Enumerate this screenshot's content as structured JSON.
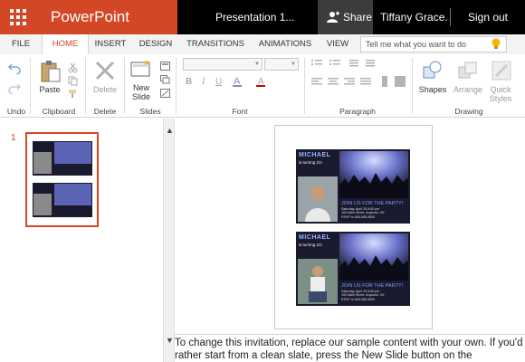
{
  "titlebar": {
    "app_name": "PowerPoint Online",
    "doc_title": "Presentation 1...",
    "share_label": "Share",
    "user": "Tiffany Grace...",
    "signout": "Sign out"
  },
  "tabs": [
    "FILE",
    "HOME",
    "INSERT",
    "DESIGN",
    "TRANSITIONS",
    "ANIMATIONS",
    "VIEW"
  ],
  "active_tab": "HOME",
  "tell_me_placeholder": "Tell me what you want to do",
  "ribbon": {
    "undo_group": "Undo",
    "clipboard_group": "Clipboard",
    "paste": "Paste",
    "delete_group": "Delete",
    "delete": "Delete",
    "slides_group": "Slides",
    "new_slide": "New Slide",
    "font_group": "Font",
    "paragraph_group": "Paragraph",
    "drawing_group": "Drawing",
    "shapes": "Shapes",
    "arrange": "Arrange",
    "quick_styles": "Quick Styles"
  },
  "thumbnail": {
    "slide_number": "1"
  },
  "card": {
    "name": "MICHAEL",
    "sub": "is turning 21!",
    "join": "JOIN US FOR THE PARTY!",
    "info": [
      "Saturday, April 25 8:00 pm",
      "100 Main Street, Anytown, NY",
      "RSVP to 555-555-5555"
    ]
  },
  "notes_text": "To change this invitation, replace our sample content with your own. If you'd rather start from a clean slate, press the New Slide button on the",
  "colors": {
    "accent": "#d24726",
    "titlebar": "#000000",
    "share_bg": "#3c3c3c"
  }
}
